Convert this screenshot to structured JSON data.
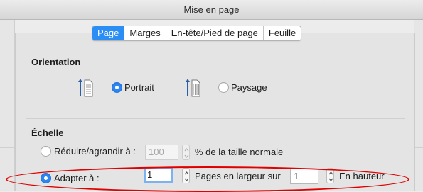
{
  "window": {
    "title": "Mise en page"
  },
  "tabs": [
    {
      "label": "Page",
      "active": true
    },
    {
      "label": "Marges",
      "active": false
    },
    {
      "label": "En-tête/Pied de page",
      "active": false
    },
    {
      "label": "Feuille",
      "active": false
    }
  ],
  "orientation": {
    "heading": "Orientation",
    "portrait_label": "Portrait",
    "landscape_label": "Paysage",
    "selected": "Portrait"
  },
  "scale": {
    "heading": "Échelle",
    "reduce_label": "Réduire/agrandir à :",
    "reduce_value": "100",
    "reduce_suffix": "% de la taille normale",
    "fit_label": "Adapter à :",
    "fit_width_value": "1",
    "fit_width_suffix": "Pages en largeur sur",
    "fit_height_value": "1",
    "fit_height_suffix": "En hauteur",
    "selected": "fit"
  },
  "colors": {
    "accent": "#2b8ef5",
    "annotation": "#e00000"
  },
  "annotation": {
    "shape": "ellipse",
    "highlights": "fit-to-row"
  }
}
